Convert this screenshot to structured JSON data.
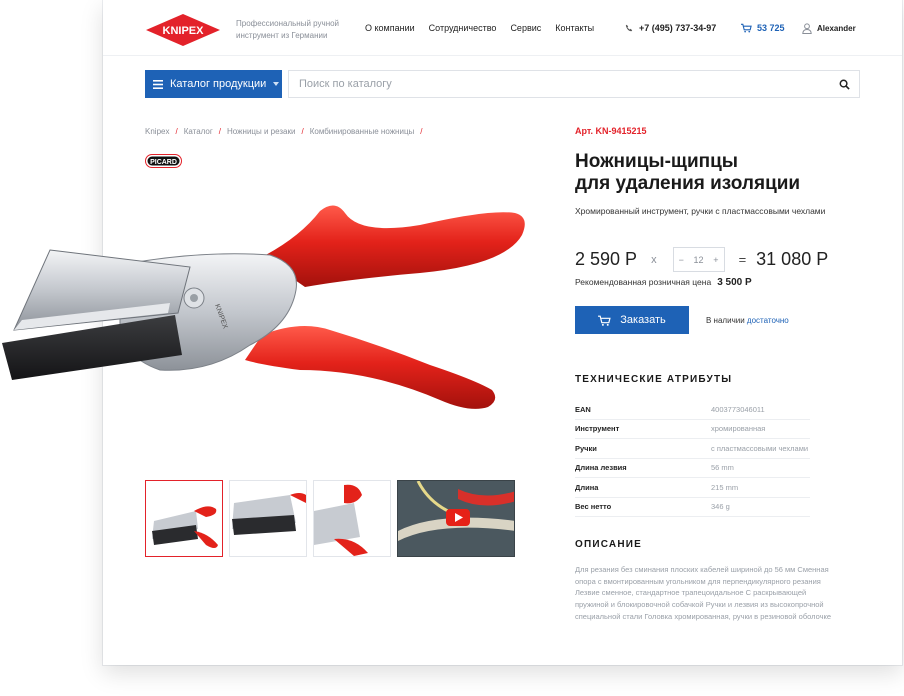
{
  "header": {
    "logo_text": "KNIPEX",
    "tagline": "Профессиональный ручной инструмент из Германии",
    "nav": [
      "О компании",
      "Сотрудничество",
      "Сервис",
      "Контакты"
    ],
    "phone": "+7 (495) 737-34-97",
    "cart_total": "53 725",
    "user_name": "Alexander"
  },
  "search": {
    "catalog_label": "Каталог продукции",
    "placeholder": "Поиск по каталогу"
  },
  "breadcrumbs": [
    "Knipex",
    "Каталог",
    "Ножницы и резаки",
    "Комбинированные ножницы"
  ],
  "brand_badge": "PICARD",
  "product": {
    "article": "Арт. KN-9415215",
    "title_line1": "Ножницы-щипцы",
    "title_line2": "для удаления изоляции",
    "subtitle": "Хромированный инструмент, ручки с пластмассовыми чехлами",
    "unit_price": "2 590 Р",
    "multiply": "x",
    "quantity": "12",
    "minus": "−",
    "plus": "+",
    "equals": "=",
    "total_price": "31 080 Р",
    "rrp_label": "Рекомендованная розничная цена",
    "rrp_value": "3 500 Р",
    "order_label": "Заказать",
    "stock_label": "В наличии",
    "stock_link": "достаточно"
  },
  "attributes": {
    "title": "ТЕХНИЧЕСКИЕ АТРИБУТЫ",
    "rows": [
      {
        "k": "EAN",
        "v": "4003773046011"
      },
      {
        "k": "Инструмент",
        "v": "хромированная"
      },
      {
        "k": "Ручки",
        "v": "с пластмассовыми чехлами"
      },
      {
        "k": "Длина лезвия",
        "v": "56 mm"
      },
      {
        "k": "Длина",
        "v": "215 mm"
      },
      {
        "k": "Вес нетто",
        "v": "346 g"
      }
    ]
  },
  "description": {
    "title": "ОПИСАНИЕ",
    "text": "Для резания без сминания плоских кабелей шириной до 56 мм Сменная опора с вмонтированным угольником для перпендикулярного резания Лезвие сменное, стандартное трапецоидальное С раскрывающей пружиной и блокировочной собачкой Ручки и лезвия из высокопрочной специальной стали Головка хромированная, ручки в резиновой оболочке"
  },
  "colors": {
    "accent": "#1e62b6",
    "brand_red": "#e3222a"
  }
}
